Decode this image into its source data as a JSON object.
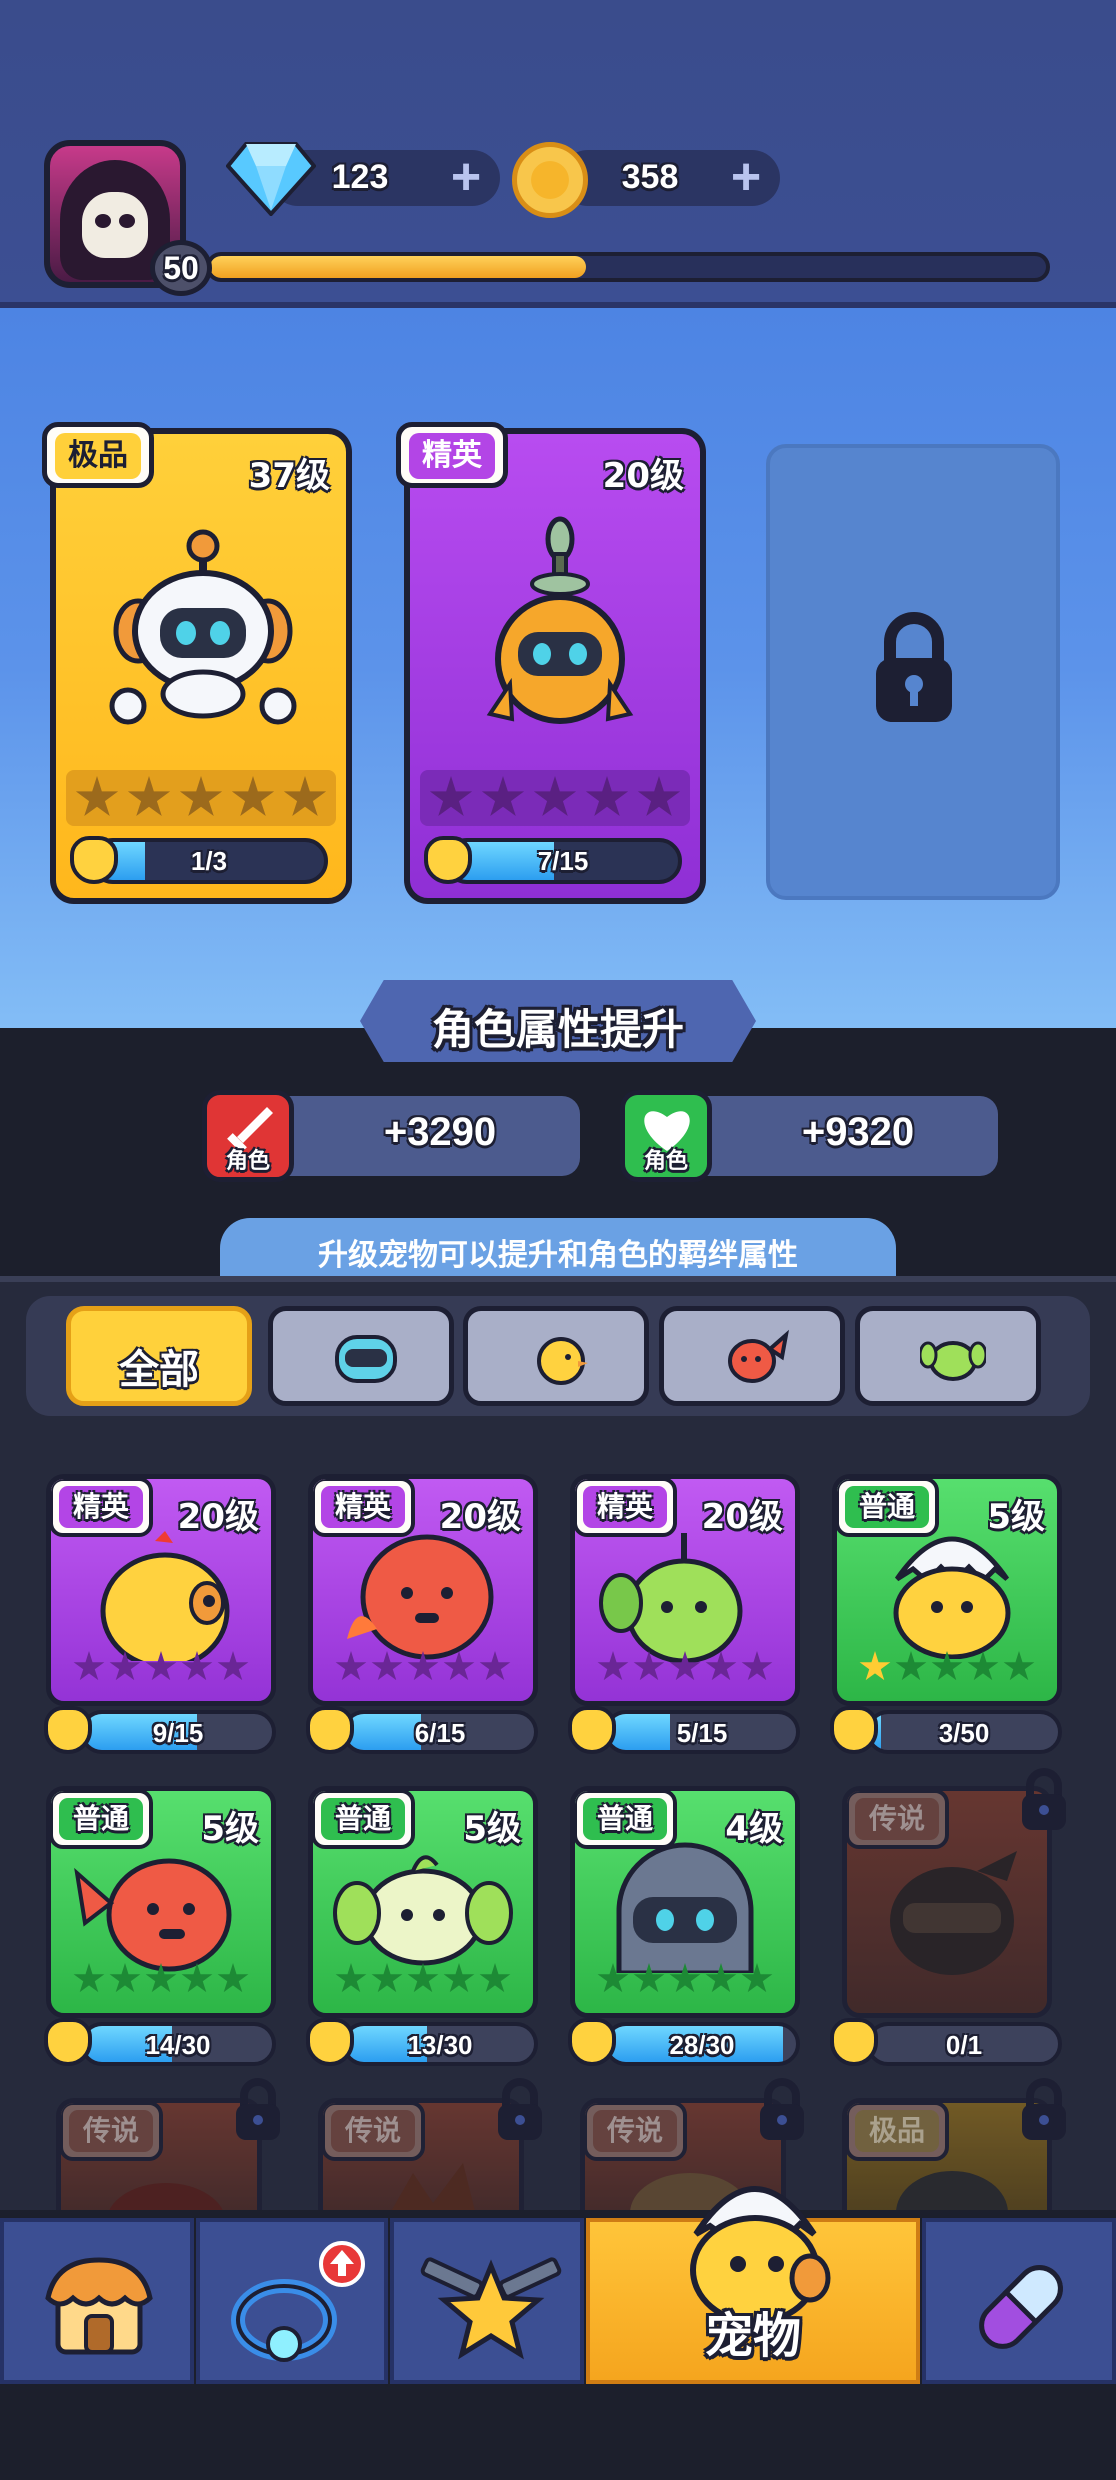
{
  "player": {
    "level": "50",
    "xp_fraction": 0.45,
    "avatar_icon": "reaper-skull-icon"
  },
  "currency": {
    "gems": "123",
    "coins": "358",
    "gem_icon": "diamond-icon",
    "coin_icon": "gold-coin-icon"
  },
  "equipped": [
    {
      "rarity": "极品",
      "level": "37级",
      "progress": "1/3",
      "progress_fraction": 0.333,
      "stars_filled": 0,
      "icon": "robot-pet-icon"
    },
    {
      "rarity": "精英",
      "level": "20级",
      "progress": "7/15",
      "progress_fraction": 0.467,
      "stars_filled": 0,
      "icon": "drone-pet-icon"
    },
    {
      "locked": true,
      "icon": "lock-icon"
    }
  ],
  "section_title": "角色属性提升",
  "bonuses": [
    {
      "icon": "sword-icon",
      "label": "角色",
      "value": "+3290"
    },
    {
      "icon": "heart-icon",
      "label": "角色",
      "value": "+9320"
    }
  ],
  "hint": "升级宠物可以提升和角色的羁绊属性",
  "filters": [
    {
      "label": "全部",
      "active": true
    },
    {
      "icon": "robot-filter-icon"
    },
    {
      "icon": "chick-filter-icon"
    },
    {
      "icon": "fish-filter-icon"
    },
    {
      "icon": "leaf-filter-icon"
    }
  ],
  "pets": [
    {
      "rarity": "精英",
      "level": "20级",
      "progress": "9/15",
      "progress_fraction": 0.6,
      "stars_filled": 0,
      "icon": "chick-pet-icon"
    },
    {
      "rarity": "精英",
      "level": "20级",
      "progress": "6/15",
      "progress_fraction": 0.4,
      "stars_filled": 0,
      "icon": "octopus-pet-icon"
    },
    {
      "rarity": "精英",
      "level": "20级",
      "progress": "5/15",
      "progress_fraction": 0.333,
      "stars_filled": 0,
      "icon": "sprout-pet-icon"
    },
    {
      "rarity": "普通",
      "level": "5级",
      "progress": "3/50",
      "progress_fraction": 0.06,
      "stars_filled": 1,
      "icon": "egg-chick-pet-icon"
    },
    {
      "rarity": "普通",
      "level": "5级",
      "progress": "14/30",
      "progress_fraction": 0.467,
      "stars_filled": 0,
      "icon": "red-fish-pet-icon"
    },
    {
      "rarity": "普通",
      "level": "5级",
      "progress": "13/30",
      "progress_fraction": 0.433,
      "stars_filled": 0,
      "icon": "leaf-pet-icon"
    },
    {
      "rarity": "普通",
      "level": "4级",
      "progress": "28/30",
      "progress_fraction": 0.933,
      "stars_filled": 0,
      "icon": "helmet-robot-pet-icon"
    },
    {
      "rarity": "传说",
      "level": "",
      "progress": "0/1",
      "progress_fraction": 0,
      "locked": true,
      "icon": "ninja-pet-icon"
    },
    {
      "rarity": "传说",
      "locked": true,
      "icon": "dragon-pet-icon"
    },
    {
      "rarity": "传说",
      "locked": true,
      "icon": "demon-pet-icon"
    },
    {
      "rarity": "传说",
      "locked": true,
      "icon": "beast-pet-icon"
    },
    {
      "rarity": "极品",
      "locked": true,
      "icon": "knight-pet-icon"
    }
  ],
  "nav": [
    {
      "icon": "shop-icon"
    },
    {
      "icon": "ring-upgrade-icon",
      "badge": "up-arrow-badge-icon"
    },
    {
      "icon": "star-guns-icon"
    },
    {
      "icon": "egg-chick-icon",
      "label": "宠物",
      "active": true
    },
    {
      "icon": "capsule-icon"
    }
  ],
  "colors": {
    "elite": "#b345e6",
    "common": "#2fbe4f",
    "gold": "#ffd03a",
    "progress": "#2c9ef0"
  }
}
